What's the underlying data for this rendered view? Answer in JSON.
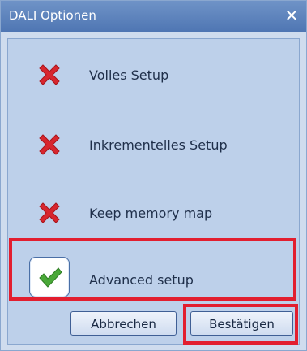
{
  "window": {
    "title": "DALI Optionen"
  },
  "options": [
    {
      "label": "Volles Setup",
      "icon": "x-cross-icon",
      "checked": false
    },
    {
      "label": "Inkrementelles Setup",
      "icon": "x-cross-icon",
      "checked": false
    },
    {
      "label": "Keep memory map",
      "icon": "x-cross-icon",
      "checked": false
    },
    {
      "label": "Advanced setup",
      "icon": "check-icon",
      "checked": true
    }
  ],
  "buttons": {
    "cancel": "Abbrechen",
    "confirm": "Bestätigen"
  },
  "colors": {
    "title_bar": "#5a7fbc",
    "panel": "#bdd0ea",
    "highlight": "#e21e2f",
    "cross": "#d7262e",
    "check": "#4aa838"
  }
}
